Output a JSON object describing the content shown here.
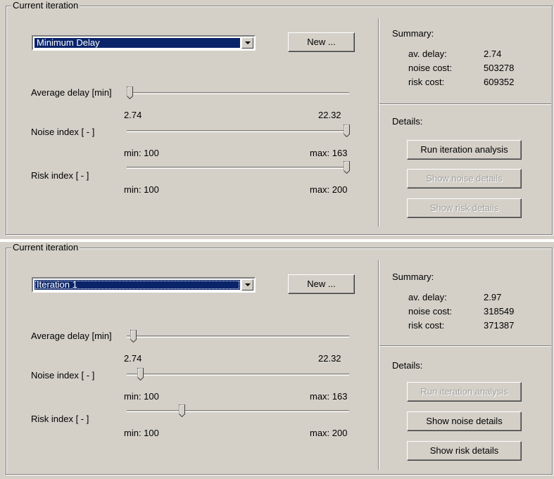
{
  "panels": [
    {
      "group_title": "Current iteration",
      "combo_value": "Minimum Delay",
      "new_button": "New ...",
      "avg_delay_label": "Average delay [min]",
      "avg_delay_min": "2.74",
      "avg_delay_max": "22.32",
      "avg_delay_level": 0.0,
      "noise_label": "Noise index [ - ]",
      "noise_min": "min: 100",
      "noise_max": "max: 163",
      "noise_level": 1.0,
      "risk_label": "Risk index [ - ]",
      "risk_min": "min: 100",
      "risk_max": "max: 200",
      "risk_level": 1.0,
      "summary_title": "Summary:",
      "summary": [
        {
          "label": "av. delay:",
          "value": "2.74"
        },
        {
          "label": "noise cost:",
          "value": "503278"
        },
        {
          "label": "risk cost:",
          "value": "609352"
        }
      ],
      "details_title": "Details:",
      "run_button": "Run iteration analysis",
      "run_enabled": true,
      "noise_button": "Show noise details",
      "noise_enabled": false,
      "risk_button": "Show risk details",
      "risk_enabled": false
    },
    {
      "group_title": "Current iteration",
      "combo_value": "Iteration 1",
      "new_button": "New ...",
      "avg_delay_label": "Average delay [min]",
      "avg_delay_min": "2.74",
      "avg_delay_max": "22.32",
      "avg_delay_level": 0.015,
      "noise_label": "Noise index [ - ]",
      "noise_min": "min: 100",
      "noise_max": "max: 163",
      "noise_level": 0.05,
      "risk_label": "Risk index [ - ]",
      "risk_min": "min: 100",
      "risk_max": "max: 200",
      "risk_level": 0.24,
      "summary_title": "Summary:",
      "summary": [
        {
          "label": "av. delay:",
          "value": "2.97"
        },
        {
          "label": "noise cost:",
          "value": "318549"
        },
        {
          "label": "risk cost:",
          "value": "371387"
        }
      ],
      "details_title": "Details:",
      "run_button": "Run iteration analysis",
      "run_enabled": false,
      "noise_button": "Show noise details",
      "noise_enabled": true,
      "risk_button": "Show risk details",
      "risk_enabled": true
    }
  ]
}
